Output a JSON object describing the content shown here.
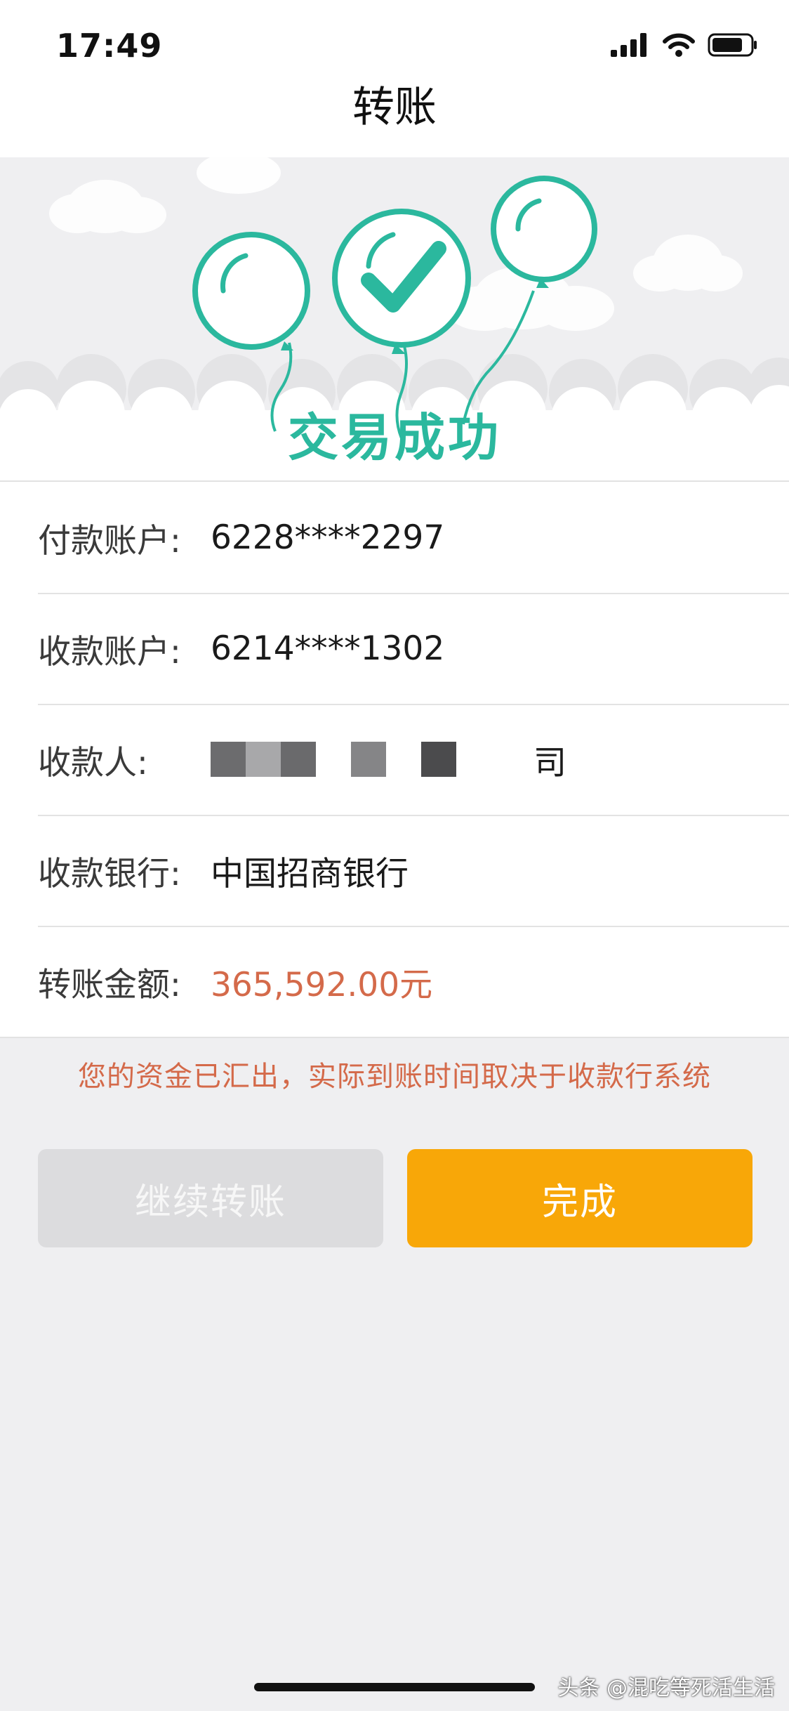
{
  "status_bar": {
    "time": "17:49",
    "icons": [
      "cellular-signal-icon",
      "wifi-icon",
      "battery-icon"
    ]
  },
  "nav": {
    "title": "转账"
  },
  "banner": {
    "illustration": [
      "balloon-icon",
      "checkmark-balloon-icon",
      "balloon-icon",
      "cloud-icon"
    ],
    "success_text": "交易成功"
  },
  "details": {
    "rows": [
      {
        "label": "付款账户:",
        "value": "6228****2297"
      },
      {
        "label": "收款账户:",
        "value": "6214****1302"
      },
      {
        "label": "收款人:",
        "value": "",
        "redacted": true,
        "trailing": "司"
      },
      {
        "label": "收款银行:",
        "value": "中国招商银行"
      },
      {
        "label": "转账金额:",
        "value": "365,592.00元"
      }
    ]
  },
  "notice": "您的资金已汇出，实际到账时间取决于收款行系统",
  "buttons": {
    "continue_label": "继续转账",
    "done_label": "完成"
  },
  "watermark": "头条 @混吃等死活生活",
  "colors": {
    "accent_green": "#2bb89e",
    "amount_red": "#d46a4a",
    "done_orange": "#f8a708",
    "disabled_gray": "#dcdcde"
  }
}
